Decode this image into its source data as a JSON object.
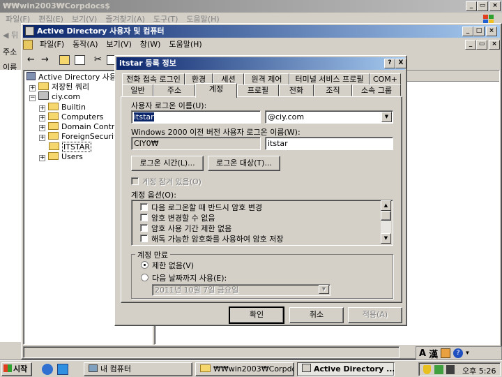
{
  "outer_window": {
    "title": "₩₩win2003₩Corpdocs$",
    "menu": [
      "파일(F)",
      "편집(E)",
      "보기(V)",
      "즐겨찾기(A)",
      "도구(T)",
      "도움말(H)"
    ],
    "back_label": "뒤",
    "address_label": "주소",
    "name_col": "이름"
  },
  "ad_window": {
    "title": "Active Directory 사용자 및 컴퓨터",
    "menu": [
      "파일(F)",
      "동작(A)",
      "보기(V)",
      "창(W)",
      "도움말(H)"
    ],
    "tree": {
      "root": "Active Directory 사용자",
      "saved_queries": "저장된 쿼리",
      "domain": "ciy.com",
      "items": [
        "Builtin",
        "Computers",
        "Domain Contro",
        "ForeignSecurit",
        "ITSTAR",
        "Users"
      ]
    }
  },
  "dialog": {
    "title": "itstar 등록 정보",
    "help_btn": "?",
    "close_btn": "X",
    "tabs_back": [
      "전화 접속 로그인",
      "환경",
      "세션",
      "원격 제어",
      "터미널 서비스 프로필",
      "COM+"
    ],
    "tabs_front": [
      "일반",
      "주소",
      "계정",
      "프로필",
      "전화",
      "조직",
      "소속 그룹"
    ],
    "active_tab": "계정",
    "logon_name_label": "사용자 로그온 이름(U):",
    "logon_name_value": "itstar",
    "domain_suffix": "@ciy.com",
    "pre2000_label": "Windows 2000 이전 버전 사용자 로그온 이름(W):",
    "pre2000_domain": "CIY0₩",
    "pre2000_user": "itstar",
    "logon_hours_btn": "로그온 시간(L)...",
    "logon_to_btn": "로그온 대상(T)...",
    "account_locked": "계정 잠겨 있음(O)",
    "account_options_label": "계정 옵션(O):",
    "account_options": [
      "다음 로그온할 때 반드시 암호 변경",
      "암호 변경할 수 없음",
      "암호 사용 기간 제한 없음",
      "해독 가능한 암호화를 사용하여 암호 저장"
    ],
    "expires_label": "계정 만료",
    "expires_never": "제한 없음(V)",
    "expires_end": "다음 날짜까지 사용(E):",
    "expires_date": "2011년 10월 7일 금요일",
    "ok_btn": "확인",
    "cancel_btn": "취소",
    "apply_btn": "적용(A)"
  },
  "statusbar": {
    "lang_a": "A",
    "lang_han": "漢"
  },
  "taskbar": {
    "start": "시작",
    "tasks": [
      "내 컴퓨터",
      "₩₩win2003₩Corpdo...",
      "Active Directory ..."
    ],
    "time": "오후 5:26"
  }
}
